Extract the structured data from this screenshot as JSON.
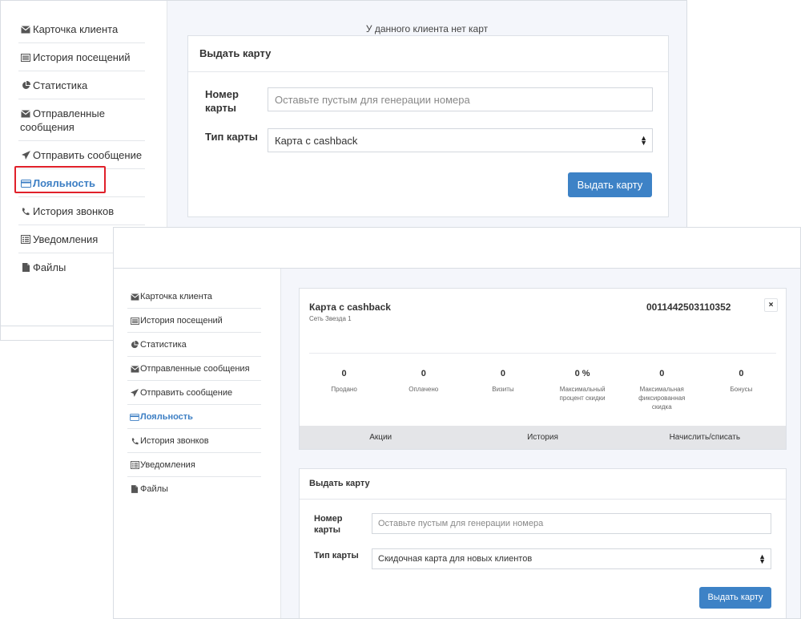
{
  "nav": [
    {
      "label": "Карточка клиента",
      "icon": "envelope-icon"
    },
    {
      "label": "История посещений",
      "icon": "list-alt-icon"
    },
    {
      "label": "Статистика",
      "icon": "pie-chart-icon"
    },
    {
      "label": "Отправленные сообщения",
      "icon": "envelope-icon"
    },
    {
      "label": "Отправить сообщение",
      "icon": "send-icon"
    },
    {
      "label": "Лояльность",
      "icon": "credit-card-icon",
      "active": true
    },
    {
      "label": "История звонков",
      "icon": "phone-icon"
    },
    {
      "label": "Уведомления",
      "icon": "list-icon"
    },
    {
      "label": "Файлы",
      "icon": "file-icon"
    }
  ],
  "panel1": {
    "no_cards_text": "У данного клиента нет карт",
    "issue_form": {
      "title": "Выдать карту",
      "number_label": "Номер карты",
      "number_placeholder": "Оставьте пустым для генерации номера",
      "type_label": "Тип карты",
      "type_value": "Карта с cashback",
      "submit_label": "Выдать карту"
    }
  },
  "panel2": {
    "card": {
      "title": "Карта с cashback",
      "subtitle": "Сеть Звезда 1",
      "number": "0011442503110352",
      "close_label": "×",
      "stats": [
        {
          "value": "0",
          "label": "Продано"
        },
        {
          "value": "0",
          "label": "Оплачено"
        },
        {
          "value": "0",
          "label": "Визиты"
        },
        {
          "value": "0 %",
          "label": "Максимальный процент скидки"
        },
        {
          "value": "0",
          "label": "Максимальная фиксированная скидка"
        },
        {
          "value": "0",
          "label": "Бонусы"
        }
      ],
      "tabs": [
        "Акции",
        "История",
        "Начислить/списать"
      ]
    },
    "issue_form": {
      "title": "Выдать карту",
      "number_label": "Номер карты",
      "number_placeholder": "Оставьте пустым для генерации номера",
      "type_label": "Тип карты",
      "type_value": "Скидочная карта для новых клиентов",
      "submit_label": "Выдать карту"
    }
  },
  "colors": {
    "accent": "#3d82c6",
    "highlight": "#e0202a",
    "background": "#f4f6fb"
  }
}
